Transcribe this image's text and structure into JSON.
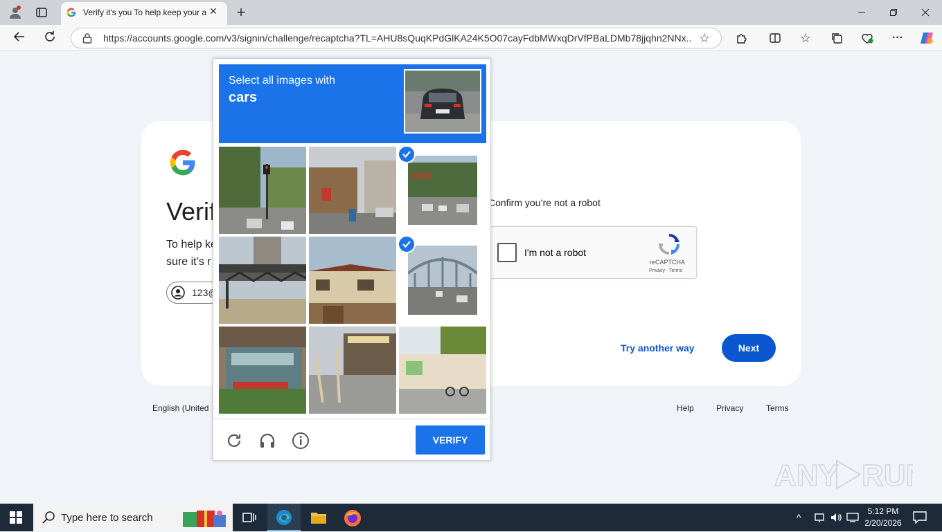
{
  "browser": {
    "tab_title": "Verify it's you To help keep your a",
    "url": "https://accounts.google.com/v3/signin/challenge/recaptcha?TL=AHU8sQuqKPdGlKA24K5O07cayFdbMWxqDrVfPBaLDMb78jjqhn2NNx..."
  },
  "page": {
    "heading_partial": "Verif",
    "body_line1": "To help ke",
    "body_line2": "sure it’s r",
    "account_chip": "123@",
    "confirm_text": "Confirm you’re not a robot",
    "try_another": "Try another way",
    "next": "Next",
    "footer_lang": "English (United",
    "footer_help": "Help",
    "footer_privacy": "Privacy",
    "footer_terms": "Terms"
  },
  "recaptcha": {
    "checkbox_label": "I'm not a robot",
    "brand": "reCAPTCHA",
    "links": "Privacy - Terms"
  },
  "challenge": {
    "instruction": "Select all images with",
    "target": "cars",
    "verify": "VERIFY",
    "tiles": [
      {
        "selected": false
      },
      {
        "selected": false
      },
      {
        "selected": true
      },
      {
        "selected": false
      },
      {
        "selected": false
      },
      {
        "selected": true
      },
      {
        "selected": false
      },
      {
        "selected": false
      },
      {
        "selected": false
      }
    ]
  },
  "taskbar": {
    "search_placeholder": "Type here to search",
    "time": "5:12 PM",
    "date": "2/20/2026"
  },
  "watermark": "ANY RUN",
  "colors": {
    "accent": "#1a73e8",
    "google_blue": "#0b57d0"
  }
}
